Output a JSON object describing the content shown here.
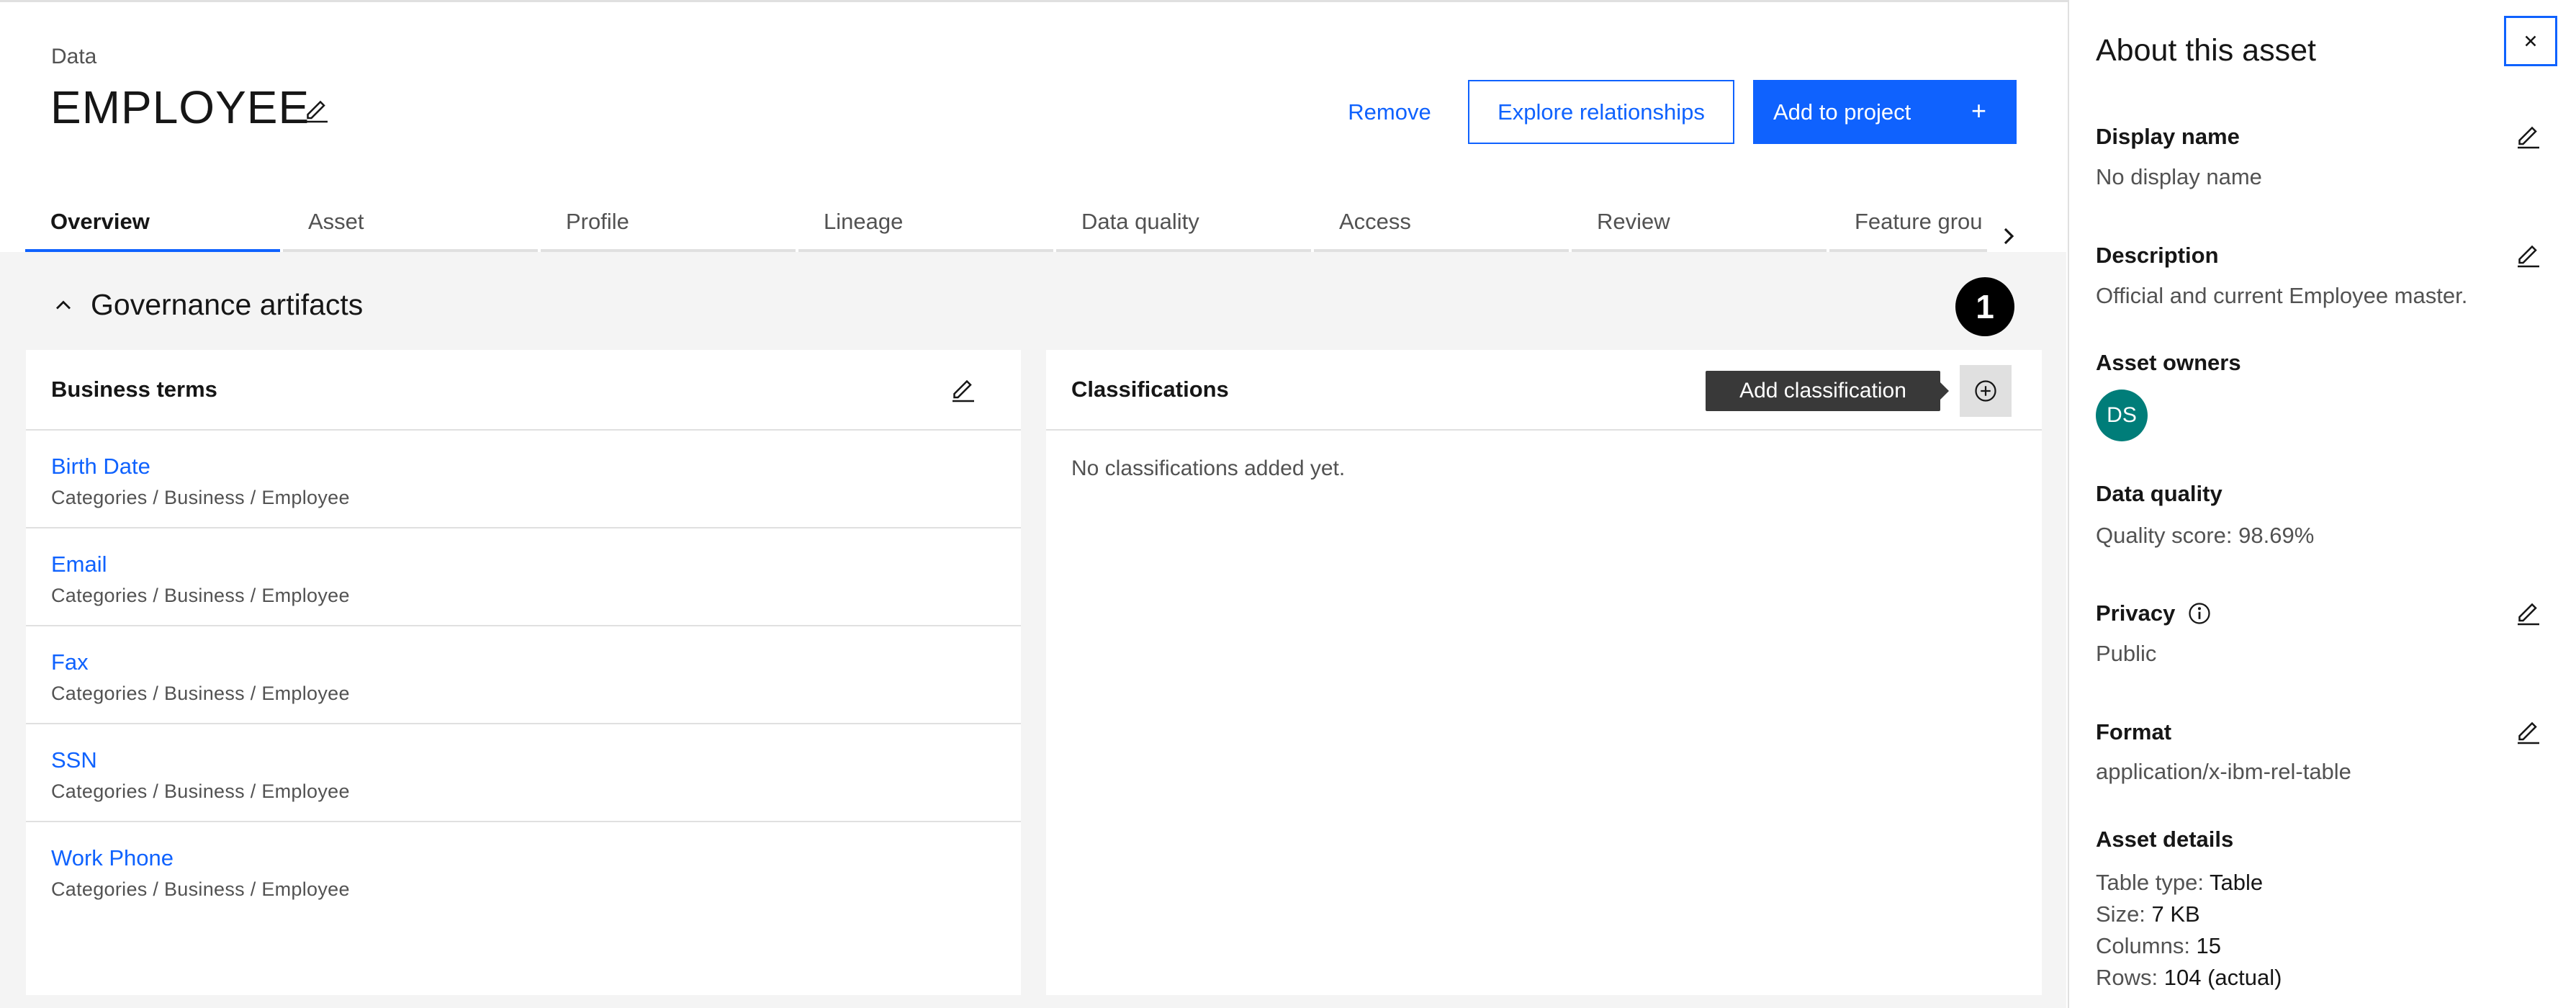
{
  "header": {
    "breadcrumb": "Data",
    "title": "EMPLOYEE",
    "remove_label": "Remove",
    "explore_label": "Explore relationships",
    "add_label": "Add to project",
    "add_icon": "+"
  },
  "tabs": [
    {
      "label": "Overview",
      "active": true
    },
    {
      "label": "Asset",
      "active": false
    },
    {
      "label": "Profile",
      "active": false
    },
    {
      "label": "Lineage",
      "active": false
    },
    {
      "label": "Data quality",
      "active": false
    },
    {
      "label": "Access",
      "active": false
    },
    {
      "label": "Review",
      "active": false
    },
    {
      "label": "Feature grou",
      "active": false
    }
  ],
  "governance": {
    "title": "Governance artifacts",
    "step_badge": "1",
    "business_terms": {
      "title": "Business terms",
      "items": [
        {
          "name": "Birth Date",
          "path": "Categories  / Business / Employee"
        },
        {
          "name": "Email",
          "path": "Categories  / Business / Employee"
        },
        {
          "name": "Fax",
          "path": "Categories  / Business / Employee"
        },
        {
          "name": "SSN",
          "path": "Categories  / Business / Employee"
        },
        {
          "name": "Work Phone",
          "path": "Categories  / Business / Employee"
        }
      ]
    },
    "classifications": {
      "title": "Classifications",
      "empty_text": "No classifications added yet.",
      "tooltip": "Add classification"
    }
  },
  "panel": {
    "title": "About this asset",
    "display_name_label": "Display name",
    "display_name_value": "No display name",
    "description_label": "Description",
    "description_value": "Official and current Employee master.",
    "owners_label": "Asset owners",
    "owner_initials": "DS",
    "quality_label": "Data quality",
    "quality_value": "Quality score: 98.69%",
    "privacy_label": "Privacy",
    "privacy_value": "Public",
    "format_label": "Format",
    "format_value": "application/x-ibm-rel-table",
    "details_label": "Asset details",
    "details": [
      {
        "key": "Table type: ",
        "value": "Table"
      },
      {
        "key": "Size: ",
        "value": "7 KB"
      },
      {
        "key": "Columns: ",
        "value": "15"
      },
      {
        "key": "Rows: ",
        "value": "104 (actual)"
      }
    ]
  },
  "colors": {
    "accent": "#0f62fe",
    "avatar": "#007d79",
    "tooltip": "#393939"
  }
}
